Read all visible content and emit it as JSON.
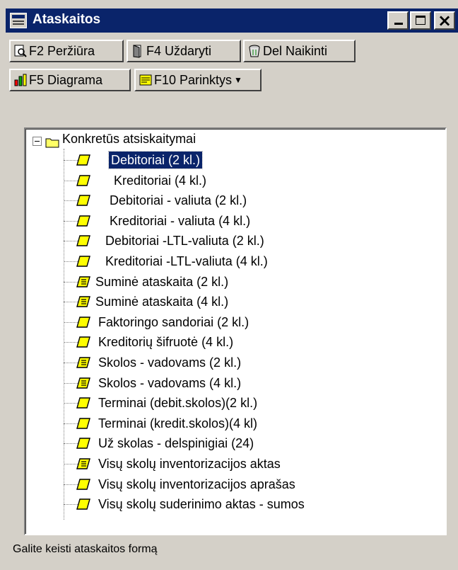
{
  "window": {
    "title": "Ataskaitos"
  },
  "toolbar": {
    "preview_label": "F2 Peržiūra",
    "close_label": "F4 Uždaryti",
    "delete_label": "Del Naikinti",
    "chart_label": "F5 Diagrama",
    "options_label": "F10 Parinktys"
  },
  "tree": {
    "root_label": "Konkretūs atsiskaitymai",
    "items": [
      {
        "label": "Debitoriai (2 kl.)",
        "icon": "report-icon",
        "selected": true
      },
      {
        "label": "Kreditoriai (4 kl.)",
        "icon": "report-icon"
      },
      {
        "label": "Debitoriai - valiuta (2 kl.)",
        "icon": "report-icon"
      },
      {
        "label": "Kreditoriai - valiuta (4 kl.)",
        "icon": "report-icon"
      },
      {
        "label": "Debitoriai -LTL-valiuta (2 kl.)",
        "icon": "report-icon"
      },
      {
        "label": "Kreditoriai -LTL-valiuta (4 kl.)",
        "icon": "report-icon"
      },
      {
        "label": "Suminė ataskaita (2 kl.)",
        "icon": "summary-report-icon"
      },
      {
        "label": "Suminė ataskaita (4 kl.)",
        "icon": "summary-report-icon"
      },
      {
        "label": "Faktoringo sandoriai (2 kl.)",
        "icon": "report-icon"
      },
      {
        "label": "Kreditorių šifruotė (4 kl.)",
        "icon": "report-icon"
      },
      {
        "label": "Skolos - vadovams (2 kl.)",
        "icon": "summary-report-icon"
      },
      {
        "label": "Skolos - vadovams (4 kl.)",
        "icon": "summary-report-icon"
      },
      {
        "label": "Terminai (debit.skolos)(2 kl.)",
        "icon": "report-icon"
      },
      {
        "label": "Terminai (kredit.skolos)(4 kl)",
        "icon": "report-icon"
      },
      {
        "label": "Už skolas - delspinigiai (24)",
        "icon": "report-icon"
      },
      {
        "label": "Visų skolų inventorizacijos aktas",
        "icon": "summary-report-icon"
      },
      {
        "label": "Visų skolų inventorizacijos aprašas",
        "icon": "report-icon"
      },
      {
        "label": "Visų skolų suderinimo aktas - sumos",
        "icon": "report-icon"
      }
    ]
  },
  "status": {
    "text": "Galite keisti ataskaitos formą"
  },
  "colors": {
    "titlebar": "#0a246a",
    "face": "#d4d0c8",
    "selection": "#0a246a",
    "icon_yellow": "#ffff00"
  }
}
